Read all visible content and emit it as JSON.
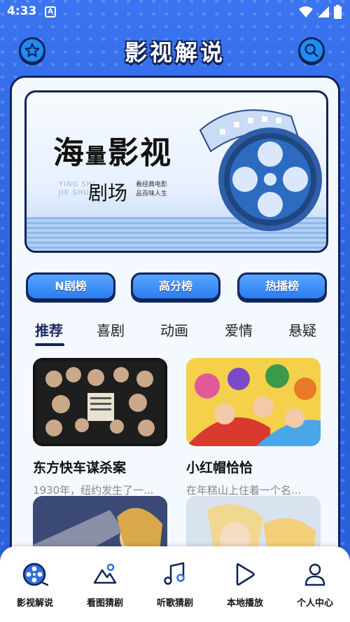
{
  "status_bar": {
    "time": "4:33"
  },
  "header": {
    "title": "影视解说",
    "left_icon": "star-icon",
    "right_icon": "search-icon"
  },
  "banner": {
    "title_main": "海",
    "title_small": "量",
    "title_tail": "影视",
    "subtitle": "剧场",
    "pinyin_line1": "YING SHI",
    "pinyin_line2": "JIE SHUO",
    "tag_line1": "看经典电影",
    "tag_line2": "品百味人生"
  },
  "rank_buttons": [
    "N剧榜",
    "高分榜",
    "热播榜"
  ],
  "tabs": [
    "推荐",
    "喜剧",
    "动画",
    "爱情",
    "悬疑"
  ],
  "active_tab": 0,
  "cards": [
    {
      "title": "东方快车谋杀案",
      "desc": "1930年，纽约发生了一..."
    },
    {
      "title": "小红帽恰恰",
      "desc": "在年糕山上住着一个名..."
    },
    {
      "title": "",
      "desc": ""
    },
    {
      "title": "",
      "desc": ""
    }
  ],
  "bottom_nav": [
    {
      "label": "影视解说",
      "icon": "film-reel-icon",
      "active": true
    },
    {
      "label": "看图猜剧",
      "icon": "image-mountain-icon"
    },
    {
      "label": "听歌猜剧",
      "icon": "music-note-icon"
    },
    {
      "label": "本地播放",
      "icon": "play-icon"
    },
    {
      "label": "个人中心",
      "icon": "person-icon"
    }
  ],
  "colors": {
    "background": "#2f66e0",
    "outline": "#10245a",
    "accent": "#2b7cf0",
    "panel": "#f4f8ff"
  }
}
